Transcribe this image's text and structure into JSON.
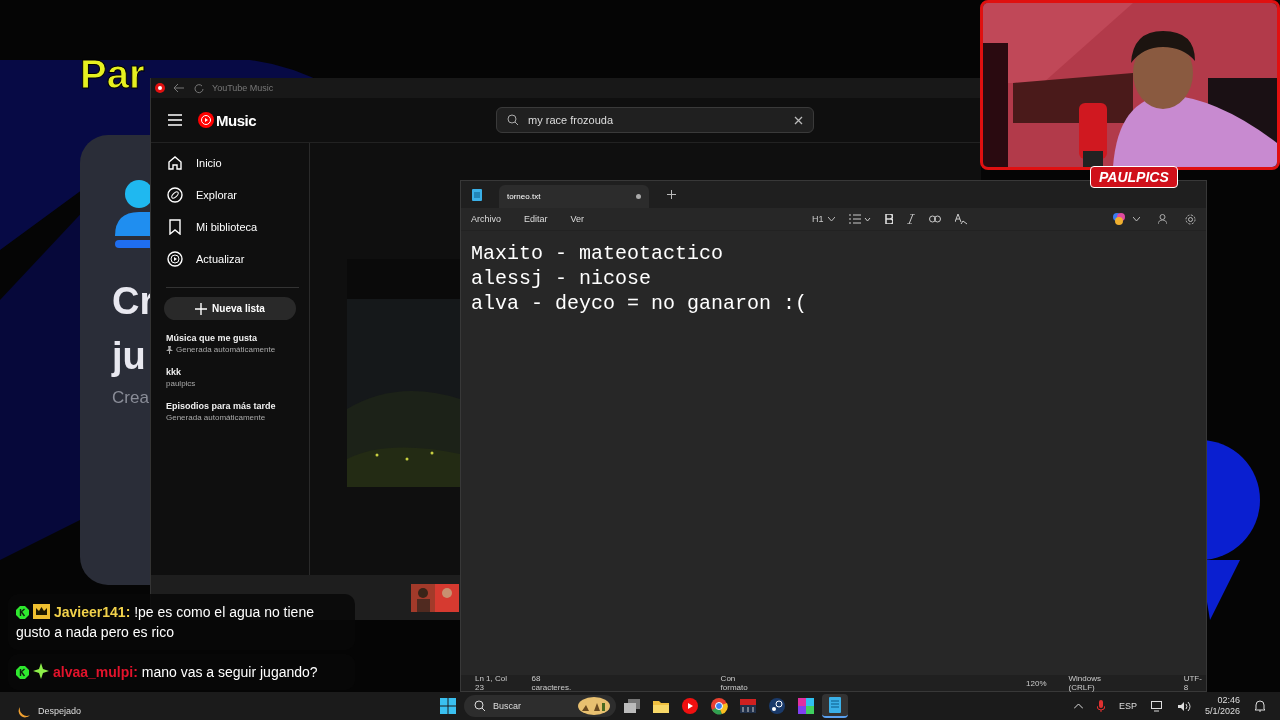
{
  "overlay_title": "Par",
  "background_card": {
    "lines": [
      "Cr",
      "ju",
      "Crea"
    ]
  },
  "youtube_music": {
    "title": "YouTube Music",
    "logo": "Music",
    "search": {
      "value": "my race frozouda"
    },
    "nav": [
      {
        "label": "Inicio",
        "kind": "home"
      },
      {
        "label": "Explorar",
        "kind": "compass"
      },
      {
        "label": "Mi biblioteca",
        "kind": "bookmark"
      },
      {
        "label": "Actualizar",
        "kind": "disc"
      }
    ],
    "new_playlist": "Nueva lista",
    "playlists": [
      {
        "title": "Música que me gusta",
        "subtitle": "Generada automáticamente",
        "pinned": true
      },
      {
        "title": "kkk",
        "subtitle": "paulpics",
        "pinned": false
      },
      {
        "title": "Episodios para más tarde",
        "subtitle": "Generada automáticamente",
        "pinned": false
      }
    ]
  },
  "notepad": {
    "tab": {
      "title": "torneo.txt",
      "unsaved": true
    },
    "menu": [
      "Archivo",
      "Editar",
      "Ver"
    ],
    "heading_button": "H1",
    "lines": [
      "Maxito - mateotactico",
      "alessj - nicose",
      "alva - deyco = no ganaron :("
    ],
    "status": {
      "position": "Ln 1, Col 23",
      "characters": "68 caracteres.",
      "format": "Con formato",
      "zoom": "120%",
      "line_endings": "Windows (CRLF)",
      "encoding": "UTF-8"
    }
  },
  "webcam": {
    "logo": "PAULPICS"
  },
  "chat": [
    {
      "user": "Javieer141:",
      "message": "!pe es como el agua no tiene gusto a nada pero es rico",
      "kind": "crown",
      "color": "#f2d24b"
    },
    {
      "user": "alvaa_mulpi:",
      "message": "mano vas a seguir jugando?",
      "kind": "sparkle",
      "color": "#e3132b"
    }
  ],
  "taskbar": {
    "weather": "Despejado",
    "search": "Buscar",
    "apps": [
      {
        "kind": "taskview",
        "selected": false
      },
      {
        "kind": "folder",
        "selected": false
      },
      {
        "kind": "ytmusic",
        "selected": false
      },
      {
        "kind": "chrome",
        "selected": false
      },
      {
        "kind": "mixer",
        "selected": false
      },
      {
        "kind": "steam",
        "selected": false
      },
      {
        "kind": "game",
        "selected": false
      },
      {
        "kind": "notepad",
        "selected": true
      }
    ],
    "language": "ESP",
    "time": "02:46",
    "date": "5/1/2026"
  }
}
